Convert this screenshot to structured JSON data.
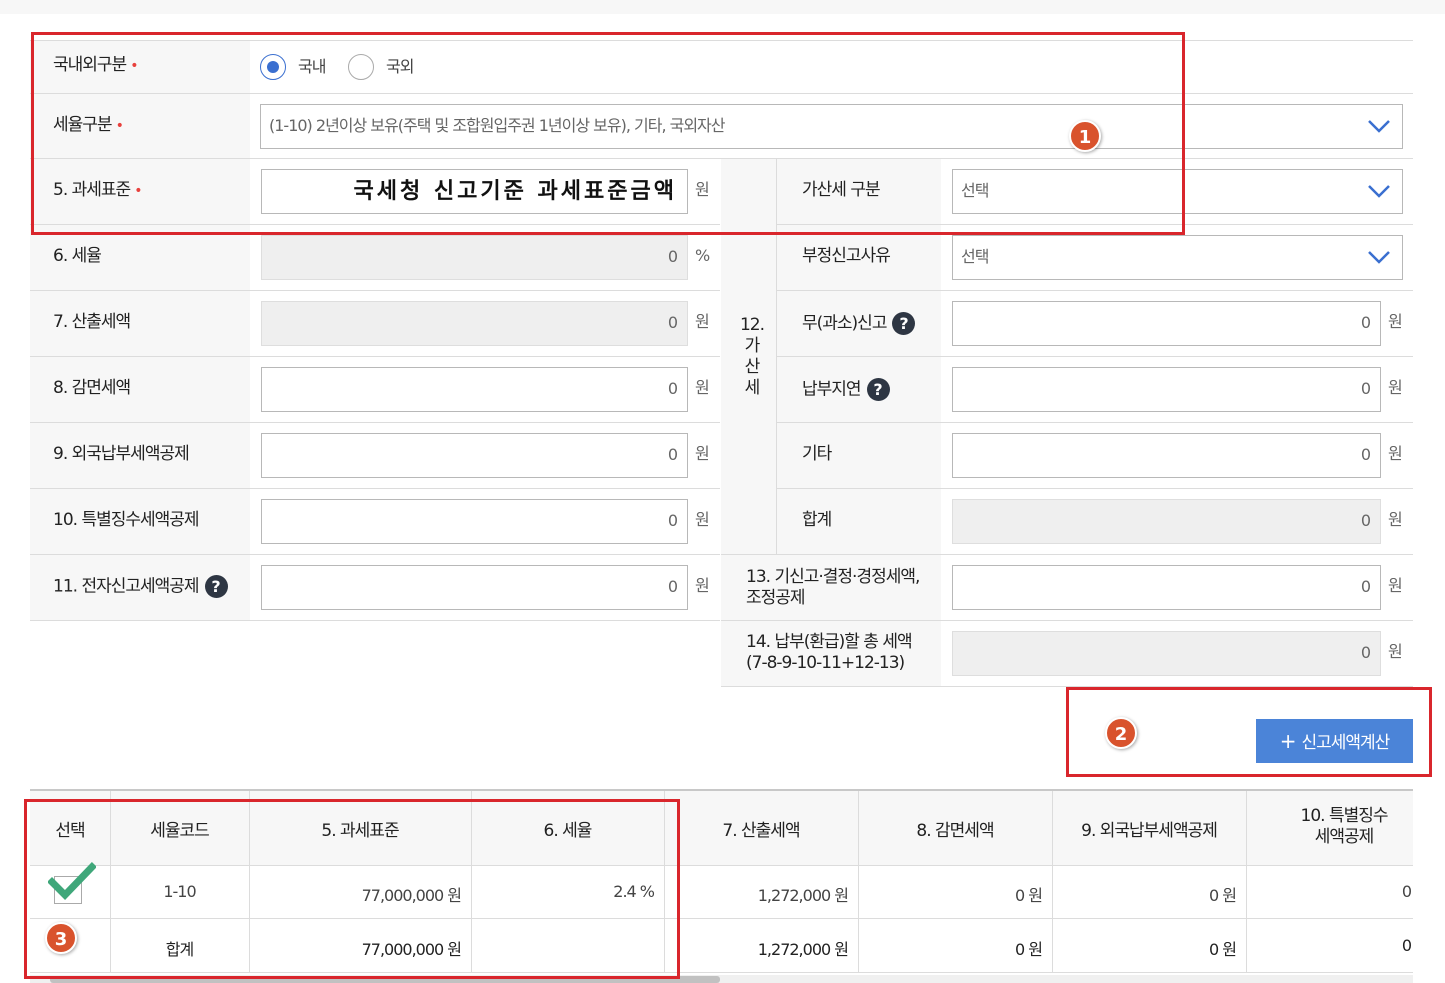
{
  "form": {
    "domestic": {
      "label": "국내외구분",
      "options": [
        "국내",
        "국외"
      ],
      "selected": "국내"
    },
    "tax_rate_type": {
      "label": "세율구분",
      "value": "(1-10) 2년이상 보유(주택 및 조합원입주권 1년이상 보유), 기타, 국외자산"
    },
    "tax_base": {
      "label": "5. 과세표준",
      "value": "국세청 신고기준 과세표준금액",
      "unit": "원"
    },
    "tax_rate": {
      "label": "6. 세율",
      "value": "0",
      "unit": "%"
    },
    "calc_tax": {
      "label": "7. 산출세액",
      "value": "0",
      "unit": "원"
    },
    "reduction": {
      "label": "8. 감면세액",
      "value": "0",
      "unit": "원"
    },
    "foreign_credit": {
      "label": "9. 외국납부세액공제",
      "value": "0",
      "unit": "원"
    },
    "withholding_credit": {
      "label": "10. 특별징수세액공제",
      "value": "0",
      "unit": "원"
    },
    "e_filing_credit": {
      "label": "11. 전자신고세액공제",
      "value": "0",
      "unit": "원"
    },
    "penalty": {
      "group_label_line1": "12.",
      "group_label_chars": [
        "가",
        "산",
        "세"
      ],
      "type": {
        "label": "가산세 구분",
        "value": "선택"
      },
      "reason": {
        "label": "부정신고사유",
        "value": "선택"
      },
      "no_report": {
        "label": "무(과소)신고",
        "value": "0",
        "unit": "원"
      },
      "late_payment": {
        "label": "납부지연",
        "value": "0",
        "unit": "원"
      },
      "other": {
        "label": "기타",
        "value": "0",
        "unit": "원"
      },
      "total": {
        "label": "합계",
        "value": "0",
        "unit": "원"
      }
    },
    "prior": {
      "label_line1": "13. 기신고·결정·경정세액,",
      "label_line2": "조정공제",
      "value": "0",
      "unit": "원"
    },
    "payable": {
      "label_line1": "14. 납부(환급)할 총 세액",
      "label_line2": "(7-8-9-10-11+12-13)",
      "value": "0",
      "unit": "원"
    },
    "calc_button": "신고세액계산",
    "help_glyph": "?"
  },
  "annotations": {
    "badge1": "1",
    "badge2": "2",
    "badge3": "3"
  },
  "table": {
    "headers": [
      "선택",
      "세율코드",
      "5. 과세표준",
      "6. 세율",
      "7. 산출세액",
      "8. 감면세액",
      "9. 외국납부세액공제"
    ],
    "header_last_line1": "10. 특별징수",
    "header_last_line2": "세액공제",
    "rows": [
      {
        "code": "1-10",
        "base": "77,000,000 원",
        "rate": "2.4 %",
        "calc": "1,272,000 원",
        "reduction": "0 원",
        "foreign": "0 원",
        "withholding": "0"
      },
      {
        "code": "합계",
        "base": "77,000,000 원",
        "rate": "",
        "calc": "1,272,000 원",
        "reduction": "0 원",
        "foreign": "0 원",
        "withholding": "0"
      }
    ]
  },
  "colors": {
    "accent": "#4b84d8",
    "annotation_red": "#d9262c",
    "badge": "#d9532d",
    "check_green": "#3fa77a"
  }
}
